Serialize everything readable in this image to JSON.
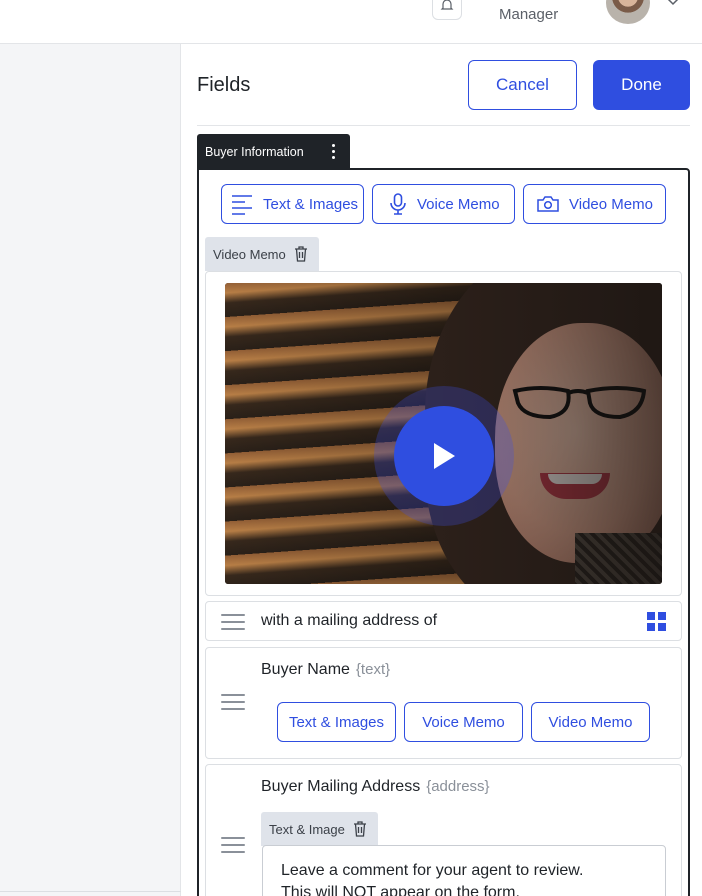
{
  "header": {
    "role": "Manager"
  },
  "fields": {
    "title": "Fields",
    "cancel_label": "Cancel",
    "done_label": "Done"
  },
  "section": {
    "title": "Buyer Information",
    "add_buttons": [
      {
        "label": "Text & Images",
        "icon": "text-lines-icon"
      },
      {
        "label": "Voice Memo",
        "icon": "microphone-icon"
      },
      {
        "label": "Video Memo",
        "icon": "camera-icon"
      }
    ],
    "video_memo_label": "Video Memo",
    "text_row": "with a mailing address of",
    "buyer_name": {
      "label": "Buyer Name",
      "type_hint": "{text}",
      "buttons": [
        "Text & Images",
        "Voice Memo",
        "Video Memo"
      ]
    },
    "buyer_address": {
      "label": "Buyer Mailing Address",
      "type_hint": "{address}",
      "chip_label": "Text & Image",
      "comment_line1": "Leave a comment for your agent to review.",
      "comment_line2": "This will NOT appear on the form."
    }
  },
  "colors": {
    "accent": "#2f4ee0",
    "dark": "#1f2328",
    "chip_bg": "#dfe3ea"
  }
}
